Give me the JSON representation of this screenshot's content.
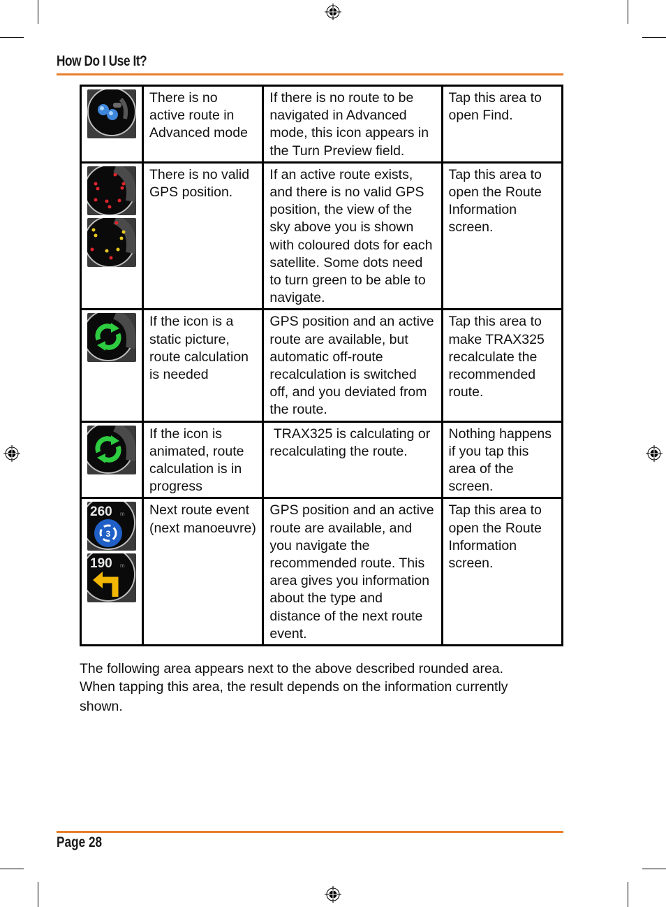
{
  "header": {
    "title": "How Do I Use It?"
  },
  "colors": {
    "accent_rule": "#e87f2a",
    "border": "#000000"
  },
  "table": {
    "rows": [
      {
        "icons": [
          "binoculars-icon"
        ],
        "condition": "There is no active route in Advanced mode",
        "description": "If there is no route to be navigated in Advanced mode, this icon appears in the Turn Preview field.",
        "action": "Tap this area to open Find."
      },
      {
        "icons": [
          "satellite-sky-red-icon",
          "satellite-sky-yellow-icon"
        ],
        "condition": "There is no valid GPS position.",
        "description": "If an active route exists, and there is no valid GPS position, the view of the sky above you is shown with coloured dots for each satellite. Some dots need to turn green to be able to navigate.",
        "action": "Tap this area to open the Route Information screen."
      },
      {
        "icons": [
          "recalculate-icon"
        ],
        "condition": "If the icon is a static picture, route calculation is needed",
        "description": "GPS position and an active route are available, but automatic off-route recalculation is switched off, and you deviated from the route.",
        "action": "Tap this area to make TRAX325 recalculate the recommended route."
      },
      {
        "icons": [
          "recalculating-animated-icon"
        ],
        "condition": "If the icon is animated, route calculation is in progress",
        "description": " TRAX325 is calculating or recalculating the route.",
        "action": "Nothing happens if you tap this area of the screen."
      },
      {
        "icons": [
          "roundabout-exit-icon",
          "turn-left-icon"
        ],
        "icon_labels": {
          "roundabout_distance": "260",
          "roundabout_unit": "m",
          "roundabout_exit": "3",
          "turn_distance": "190",
          "turn_unit": "m"
        },
        "condition": "Next route event (next manoeuvre)",
        "description": "GPS position and an active route are available, and you navigate the recommended route. This area gives you information about the type and distance of the next route event.",
        "action": "Tap this area to open the Route Information screen."
      }
    ]
  },
  "paragraph": {
    "line1": "The following area appears next to the above described rounded area.",
    "line2": "When tapping this area, the result depends on the information currently",
    "line3": "shown."
  },
  "footer": {
    "page_label": "Page 28"
  }
}
